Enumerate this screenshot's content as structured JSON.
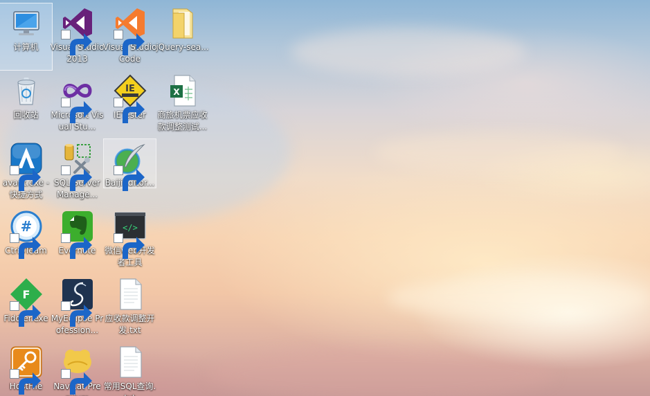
{
  "desktop": {
    "icons": [
      {
        "label": "计算机",
        "icon": "computer-icon",
        "shortcut": false
      },
      {
        "label": "Visual Studio 2013",
        "icon": "visual-studio-2013-icon",
        "shortcut": true
      },
      {
        "label": "Visual Studio Code",
        "icon": "vscode-icon",
        "shortcut": true
      },
      {
        "label": "jQuery-sea...",
        "icon": "folder-icon",
        "shortcut": false
      },
      {
        "label": "回收站",
        "icon": "recycle-bin-icon",
        "shortcut": false
      },
      {
        "label": "Microsoft Visual Stu...",
        "icon": "visual-studio-infinity-icon",
        "shortcut": true
      },
      {
        "label": "IETester",
        "icon": "ietester-icon",
        "shortcut": true
      },
      {
        "label": "商旅机票应收款调整测试...",
        "icon": "excel-file-icon",
        "shortcut": false
      },
      {
        "label": "avant.exe - 快捷方式",
        "icon": "avant-browser-icon",
        "shortcut": true
      },
      {
        "label": "SQL Server Manage...",
        "icon": "sql-server-icon",
        "shortcut": true
      },
      {
        "label": "BaijiEditor...",
        "icon": "baiji-editor-icon",
        "shortcut": true
      },
      {
        "label": "CtripTeam",
        "icon": "ctripteam-icon",
        "shortcut": true
      },
      {
        "label": "Evernote",
        "icon": "evernote-icon",
        "shortcut": true
      },
      {
        "label": "微信web开发者工具",
        "icon": "wechat-devtools-icon",
        "shortcut": true
      },
      {
        "label": "Fiddler.exe",
        "icon": "fiddler-icon",
        "shortcut": true
      },
      {
        "label": "MyEclipse Profession...",
        "icon": "myeclipse-icon",
        "shortcut": true
      },
      {
        "label": "应收款调整开发.txt",
        "icon": "text-file-icon",
        "shortcut": false
      },
      {
        "label": "HostFile",
        "icon": "hostfile-icon",
        "shortcut": true
      },
      {
        "label": "Navicat Premium",
        "icon": "navicat-icon",
        "shortcut": true
      },
      {
        "label": "常用SQL查询.txt",
        "icon": "text-file-icon",
        "shortcut": false
      }
    ]
  },
  "colors": {
    "vs_purple": "#68217a",
    "vscode_orange": "#f57b2f",
    "folder_yellow": "#f3d36a",
    "excel_green": "#1e7145",
    "ietester_yellow": "#f4cf1d",
    "avant_blue": "#1a78c8",
    "evernote_green": "#3cae2d",
    "fiddler_green": "#2dae4b",
    "myeclipse_navy": "#1f3350",
    "hostfile_orange": "#e88a1a",
    "navicat_yellow": "#f2c94a"
  }
}
